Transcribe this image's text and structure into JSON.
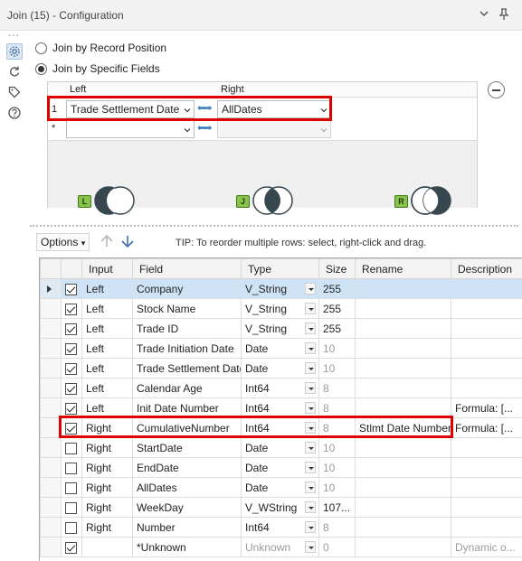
{
  "window": {
    "title": "Join (15) - Configuration",
    "more_dots": "..."
  },
  "join_mode": {
    "options": [
      {
        "label": "Join by Record Position",
        "selected": false
      },
      {
        "label": "Join by Specific Fields",
        "selected": true
      }
    ]
  },
  "join_fields": {
    "headers": {
      "left": "Left",
      "right": "Right"
    },
    "rows": [
      {
        "num": "1",
        "left": "Trade Settlement Date",
        "right": "AllDates"
      },
      {
        "num": "*",
        "left": "",
        "right": ""
      }
    ]
  },
  "venn": {
    "left_badge": "L",
    "inner_badge": "J",
    "right_badge": "R"
  },
  "options_bar": {
    "options_label": "Options",
    "tip": "TIP: To reorder multiple rows: select, right-click and drag."
  },
  "fields_table": {
    "columns": [
      "Input",
      "Field",
      "Type",
      "Size",
      "Rename",
      "Description"
    ],
    "rows": [
      {
        "checked": true,
        "input": "Left",
        "field": "Company",
        "type": "V_String",
        "size": "255",
        "rename": "",
        "description": "",
        "selected": true
      },
      {
        "checked": true,
        "input": "Left",
        "field": "Stock Name",
        "type": "V_String",
        "size": "255",
        "rename": "",
        "description": ""
      },
      {
        "checked": true,
        "input": "Left",
        "field": "Trade ID",
        "type": "V_String",
        "size": "255",
        "rename": "",
        "description": ""
      },
      {
        "checked": true,
        "input": "Left",
        "field": "Trade Initiation Date",
        "type": "Date",
        "size": "10",
        "rename": "",
        "description": ""
      },
      {
        "checked": true,
        "input": "Left",
        "field": "Trade Settlement Date",
        "type": "Date",
        "size": "10",
        "rename": "",
        "description": ""
      },
      {
        "checked": true,
        "input": "Left",
        "field": "Calendar Age",
        "type": "Int64",
        "size": "8",
        "rename": "",
        "description": ""
      },
      {
        "checked": true,
        "input": "Left",
        "field": "Init Date Number",
        "type": "Int64",
        "size": "8",
        "rename": "",
        "description": "Formula: [..."
      },
      {
        "checked": true,
        "input": "Right",
        "field": "CumulativeNumber",
        "type": "Int64",
        "size": "8",
        "rename": "Stlmt Date Number",
        "description": "Formula: [..."
      },
      {
        "checked": false,
        "input": "Right",
        "field": "StartDate",
        "type": "Date",
        "size": "10",
        "rename": "",
        "description": ""
      },
      {
        "checked": false,
        "input": "Right",
        "field": "EndDate",
        "type": "Date",
        "size": "10",
        "rename": "",
        "description": ""
      },
      {
        "checked": false,
        "input": "Right",
        "field": "AllDates",
        "type": "Date",
        "size": "10",
        "rename": "",
        "description": ""
      },
      {
        "checked": false,
        "input": "Right",
        "field": "WeekDay",
        "type": "V_WString",
        "size": "107...",
        "rename": "",
        "description": ""
      },
      {
        "checked": false,
        "input": "Right",
        "field": "Number",
        "type": "Int64",
        "size": "8",
        "rename": "",
        "description": ""
      },
      {
        "checked": true,
        "input": "",
        "field": "*Unknown",
        "type": "Unknown",
        "size": "0",
        "rename": "",
        "description": "Dynamic o..."
      }
    ]
  },
  "colors": {
    "highlight_red": "#e00000",
    "selection_blue": "#cfe3f7",
    "venn_dark": "#37474f",
    "badge_green": "#8bc34a"
  },
  "icons": [
    "gear-icon",
    "refresh-icon",
    "tag-icon",
    "help-icon",
    "chevron-down-icon",
    "pin-icon",
    "minus-icon",
    "up-arrow-icon",
    "down-arrow-icon"
  ]
}
